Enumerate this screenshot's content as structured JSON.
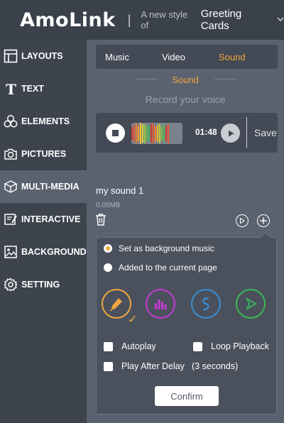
{
  "header": {
    "brand": "AmoLink",
    "separator": "|",
    "tagline": "A new style of",
    "tagline_name": "Greeting Cards"
  },
  "sidebar": {
    "items": [
      {
        "label": "LAYOUTS",
        "icon": "layout-icon",
        "active": false
      },
      {
        "label": "TEXT",
        "icon": "text-icon",
        "active": false
      },
      {
        "label": "ELEMENTS",
        "icon": "elements-icon",
        "active": false
      },
      {
        "label": "PICTURES",
        "icon": "camera-icon",
        "active": false
      },
      {
        "label": "MULTI-MEDIA",
        "icon": "box-icon",
        "active": true
      },
      {
        "label": "INTERACTIVE",
        "icon": "edit-icon",
        "active": false
      },
      {
        "label": "BACKGROUND",
        "icon": "image-icon",
        "active": false
      },
      {
        "label": "SETTING",
        "icon": "gear-icon",
        "active": false
      }
    ]
  },
  "media_tabs": [
    {
      "label": "Music",
      "active": false
    },
    {
      "label": "Video",
      "active": false
    },
    {
      "label": "Sound",
      "active": true
    }
  ],
  "sound": {
    "section_title": "Sound",
    "record_label": "Record your voice",
    "elapsed": "01:48",
    "save_label": "Save"
  },
  "file": {
    "name": "my sound 1",
    "size": "0.05MB"
  },
  "options": {
    "radio_background": "Set as background music",
    "radio_page": "Added to the current page",
    "selected": "background",
    "sources": [
      {
        "icon": "microphone-icon",
        "color": "#f0a640",
        "selected": true
      },
      {
        "icon": "equalizer-icon",
        "color": "#c63ad3"
      },
      {
        "icon": "swirl-icon",
        "color": "#3a8fd3"
      },
      {
        "icon": "play-arrow-icon",
        "color": "#3ab85a"
      }
    ],
    "autoplay_label": "Autoplay",
    "loop_label": "Loop Playback",
    "delay_label": "Play After Delay",
    "delay_value": "(3 seconds)",
    "confirm_label": "Confirm"
  },
  "colors": {
    "accent": "#f0a640",
    "sidebar_bg": "#3e444e",
    "panel_bg": "#5a6270"
  }
}
